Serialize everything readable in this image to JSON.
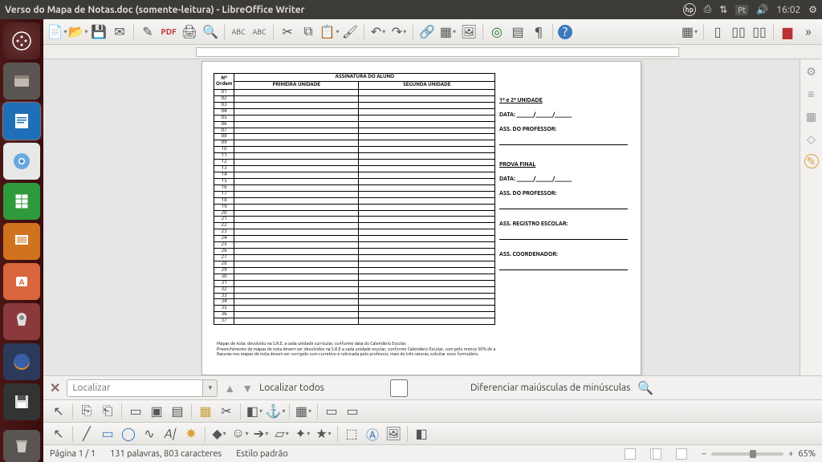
{
  "window": {
    "title": "Verso do Mapa de Notas.doc (somente-leitura) - LibreOffice Writer",
    "time": "16:02",
    "lang_indicator": "Pt"
  },
  "findbar": {
    "placeholder": "Localizar",
    "find_all": "Localizar todos",
    "match_case": "Diferenciar maiúsculas de minúsculas"
  },
  "status": {
    "page": "Página 1 / 1",
    "wordcount": "131 palavras, 803 caracteres",
    "style": "Estilo padrão",
    "zoom": "65%"
  },
  "doc": {
    "header_num": "Nº",
    "header_ordem": "Ordem",
    "header_assinatura": "ASSINATURA DO ALUNO",
    "header_primeira": "PRIMEIRA  UNIDADE",
    "header_segunda": "SEGUNDA UNIDADE",
    "rows": [
      "01",
      "02",
      "03",
      "04",
      "05",
      "06",
      "07",
      "08",
      "09",
      "10",
      "11",
      "12",
      "13",
      "14",
      "15",
      "16",
      "17",
      "18",
      "19",
      "20",
      "21",
      "22",
      "23",
      "24",
      "25",
      "26",
      "27",
      "28",
      "29",
      "30",
      "31",
      "32",
      "33",
      "34",
      "35",
      "36",
      "37"
    ],
    "right_unidade": "1ª e  2ª UNIDADE",
    "right_data": "DATA: ______/______/______",
    "right_assprof": "ASS. DO PROFESSOR:",
    "right_prova": "PROVA FINAL",
    "right_regescolar": "ASS. REGISTRO ESCOLAR:",
    "right_coordenador": "ASS. COORDENADOR:",
    "foot1": "Mapas de nota: devolvido na S.R.E. a cada unidade curricular, conforme data do Calendário Escolar.",
    "foot2": "Preenchimento de mapas de nota devem ser devolvidos na S.R.E a cada unidade escolar, conforme Calendário Escolar, com pelo menos 50% de a",
    "foot3": "Rasuras nos mapas de nota devem ser corrigido com corretivo e rubricada pelo professor, mais de três rasuras, solicitar novo formulário."
  }
}
